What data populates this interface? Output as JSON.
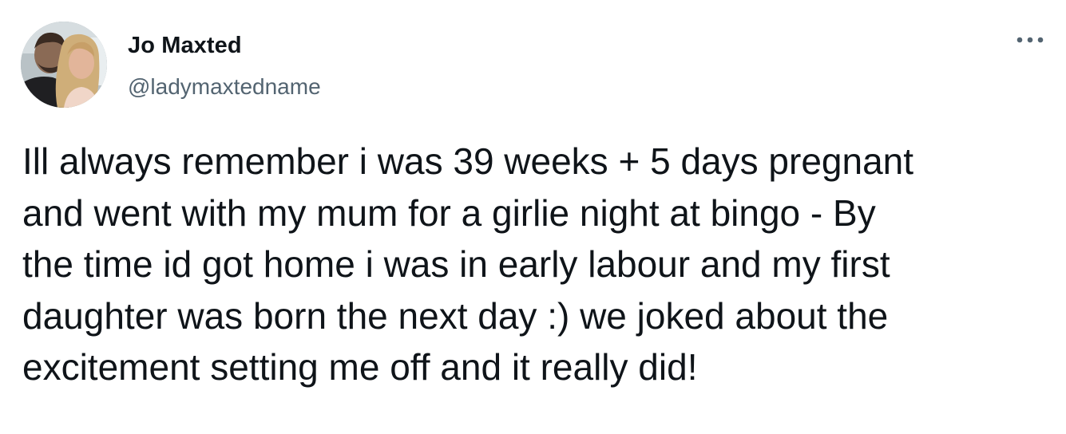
{
  "author": {
    "display_name": "Jo Maxted",
    "handle": "@ladymaxtedname",
    "avatar_icon": "profile-photo"
  },
  "menu": {
    "icon": "more-horizontal-icon"
  },
  "tweet": {
    "lines": [
      "Ill always remember i was 39 weeks + 5 days pregnant",
      "and went with my mum for a girlie night at bingo - By",
      "the time id got home i was in early labour and my first",
      "daughter was born the next day :) we joked about the",
      "excitement setting me off and it really did!"
    ]
  },
  "colors": {
    "text": "#0f1419",
    "secondary": "#536471"
  }
}
